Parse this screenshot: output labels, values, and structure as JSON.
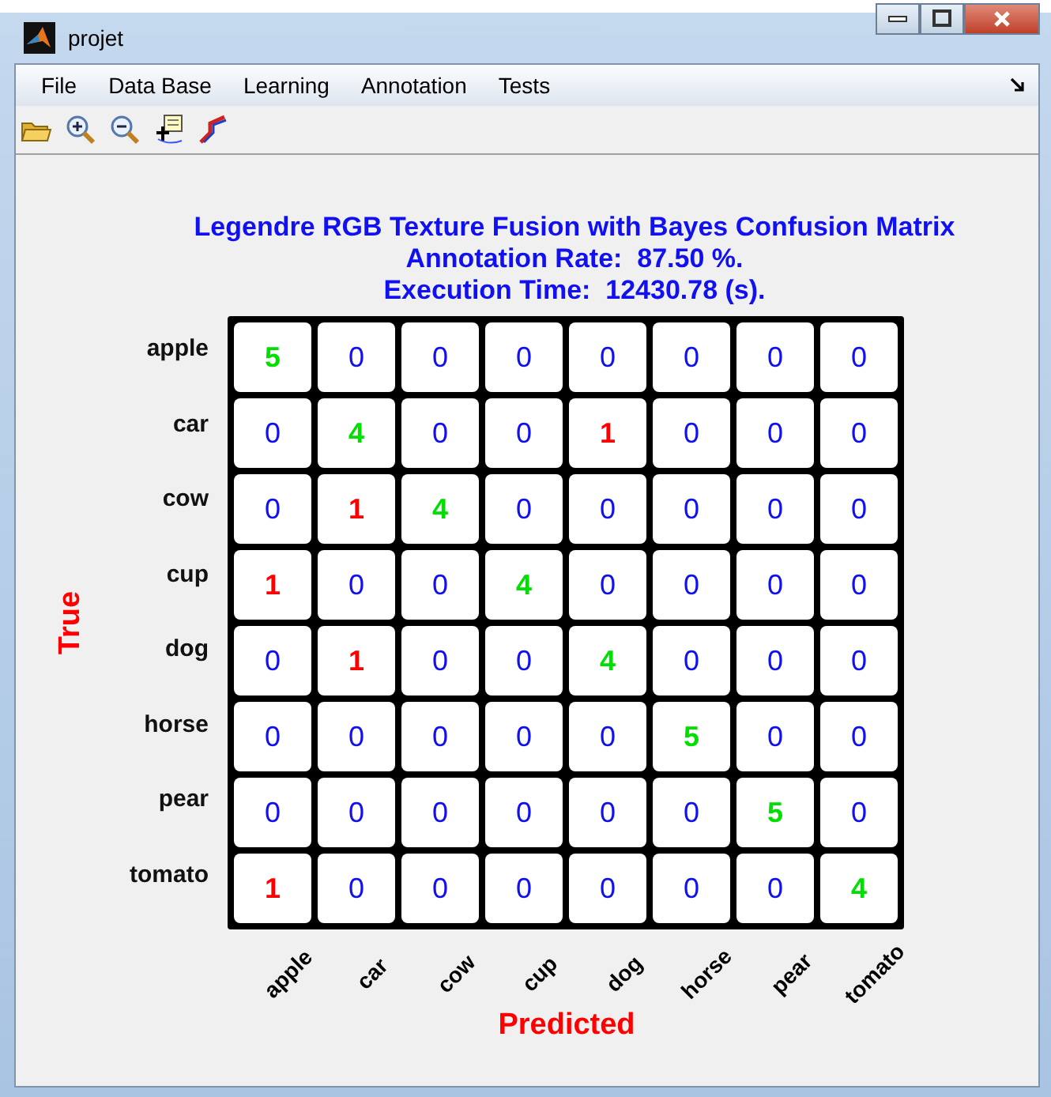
{
  "window": {
    "title": "projet"
  },
  "menu": [
    {
      "label": "File"
    },
    {
      "label": "Data Base"
    },
    {
      "label": "Learning"
    },
    {
      "label": "Annotation"
    },
    {
      "label": "Tests"
    }
  ],
  "figure": {
    "title_lines": [
      "Legendre RGB Texture Fusion with Bayes Confusion Matrix",
      "Annotation Rate:  87.50 %.",
      "Execution Time:  12430.78 (s)."
    ],
    "ylabel": "True",
    "xlabel": "Predicted",
    "row_labels": [
      "apple",
      "car",
      "cow",
      "cup",
      "dog",
      "horse",
      "pear",
      "tomato"
    ],
    "column_labels": [
      "apple",
      "car",
      "cow",
      "cup",
      "dog",
      "horse",
      "pear",
      "tomato"
    ],
    "rows": [
      [
        {
          "v": "5",
          "kind": "hit"
        },
        {
          "v": "0",
          "kind": "zero"
        },
        {
          "v": "0",
          "kind": "zero"
        },
        {
          "v": "0",
          "kind": "zero"
        },
        {
          "v": "0",
          "kind": "zero"
        },
        {
          "v": "0",
          "kind": "zero"
        },
        {
          "v": "0",
          "kind": "zero"
        },
        {
          "v": "0",
          "kind": "zero"
        }
      ],
      [
        {
          "v": "0",
          "kind": "zero"
        },
        {
          "v": "4",
          "kind": "hit"
        },
        {
          "v": "0",
          "kind": "zero"
        },
        {
          "v": "0",
          "kind": "zero"
        },
        {
          "v": "1",
          "kind": "miss"
        },
        {
          "v": "0",
          "kind": "zero"
        },
        {
          "v": "0",
          "kind": "zero"
        },
        {
          "v": "0",
          "kind": "zero"
        }
      ],
      [
        {
          "v": "0",
          "kind": "zero"
        },
        {
          "v": "1",
          "kind": "miss"
        },
        {
          "v": "4",
          "kind": "hit"
        },
        {
          "v": "0",
          "kind": "zero"
        },
        {
          "v": "0",
          "kind": "zero"
        },
        {
          "v": "0",
          "kind": "zero"
        },
        {
          "v": "0",
          "kind": "zero"
        },
        {
          "v": "0",
          "kind": "zero"
        }
      ],
      [
        {
          "v": "1",
          "kind": "miss"
        },
        {
          "v": "0",
          "kind": "zero"
        },
        {
          "v": "0",
          "kind": "zero"
        },
        {
          "v": "4",
          "kind": "hit"
        },
        {
          "v": "0",
          "kind": "zero"
        },
        {
          "v": "0",
          "kind": "zero"
        },
        {
          "v": "0",
          "kind": "zero"
        },
        {
          "v": "0",
          "kind": "zero"
        }
      ],
      [
        {
          "v": "0",
          "kind": "zero"
        },
        {
          "v": "1",
          "kind": "miss"
        },
        {
          "v": "0",
          "kind": "zero"
        },
        {
          "v": "0",
          "kind": "zero"
        },
        {
          "v": "4",
          "kind": "hit"
        },
        {
          "v": "0",
          "kind": "zero"
        },
        {
          "v": "0",
          "kind": "zero"
        },
        {
          "v": "0",
          "kind": "zero"
        }
      ],
      [
        {
          "v": "0",
          "kind": "zero"
        },
        {
          "v": "0",
          "kind": "zero"
        },
        {
          "v": "0",
          "kind": "zero"
        },
        {
          "v": "0",
          "kind": "zero"
        },
        {
          "v": "0",
          "kind": "zero"
        },
        {
          "v": "5",
          "kind": "hit"
        },
        {
          "v": "0",
          "kind": "zero"
        },
        {
          "v": "0",
          "kind": "zero"
        }
      ],
      [
        {
          "v": "0",
          "kind": "zero"
        },
        {
          "v": "0",
          "kind": "zero"
        },
        {
          "v": "0",
          "kind": "zero"
        },
        {
          "v": "0",
          "kind": "zero"
        },
        {
          "v": "0",
          "kind": "zero"
        },
        {
          "v": "0",
          "kind": "zero"
        },
        {
          "v": "5",
          "kind": "hit"
        },
        {
          "v": "0",
          "kind": "zero"
        }
      ],
      [
        {
          "v": "1",
          "kind": "miss"
        },
        {
          "v": "0",
          "kind": "zero"
        },
        {
          "v": "0",
          "kind": "zero"
        },
        {
          "v": "0",
          "kind": "zero"
        },
        {
          "v": "0",
          "kind": "zero"
        },
        {
          "v": "0",
          "kind": "zero"
        },
        {
          "v": "0",
          "kind": "zero"
        },
        {
          "v": "4",
          "kind": "hit"
        }
      ]
    ]
  }
}
